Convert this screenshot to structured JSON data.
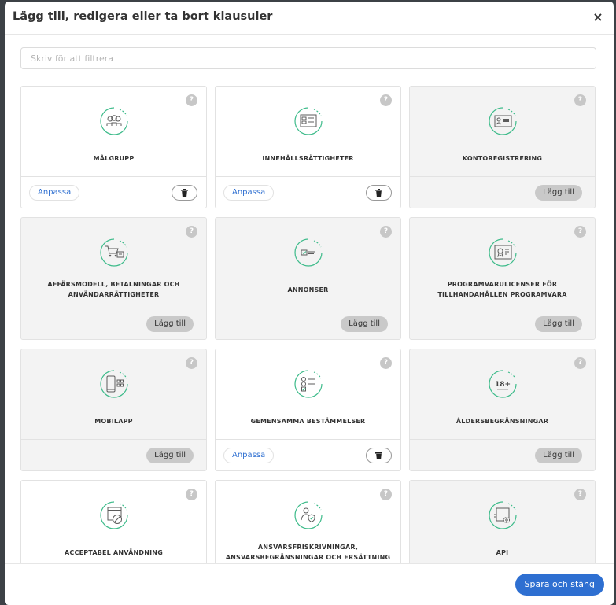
{
  "modal": {
    "title": "Lägg till, redigera eller ta bort klausuler",
    "close": "×"
  },
  "filter": {
    "placeholder": "Skriv för att filtrera",
    "value": ""
  },
  "labels": {
    "customize": "Anpassa",
    "add": "Lägg till",
    "help": "?",
    "save": "Spara och stäng"
  },
  "colors": {
    "accent": "#2e6fd1",
    "icon_green": "#3dbb8a"
  },
  "cards": [
    {
      "title": "MÅLGRUPP",
      "icon": "target-group-icon",
      "active": true
    },
    {
      "title": "INNEHÅLLSRÄTTIGHETER",
      "icon": "content-rights-icon",
      "active": true
    },
    {
      "title": "KONTOREGISTRERING",
      "icon": "account-registration-icon",
      "active": false
    },
    {
      "title": "AFFÄRSMODELL, BETALNINGAR OCH ANVÄNDARRÄTTIGHETER",
      "icon": "shopping-cart-icon",
      "active": false
    },
    {
      "title": "ANNONSER",
      "icon": "ads-icon",
      "active": false
    },
    {
      "title": "PROGRAMVARULICENSER FÖR TILLHANDAHÅLLEN PROGRAMVARA",
      "icon": "software-license-icon",
      "active": false
    },
    {
      "title": "MOBILAPP",
      "icon": "mobile-app-icon",
      "active": false
    },
    {
      "title": "GEMENSAMMA BESTÄMMELSER",
      "icon": "checklist-icon",
      "active": true
    },
    {
      "title": "ÅLDERSBEGRÄNSNINGAR",
      "icon": "age-limit-icon",
      "badge": "18+",
      "active": false
    },
    {
      "title": "ACCEPTABEL ANVÄNDNING",
      "icon": "acceptable-use-icon",
      "active": true
    },
    {
      "title": "ANSVARSFRISKRIVNINGAR, ANSVARSBEGRÄNSNINGAR OCH ERSÄTTNING",
      "icon": "liability-shield-icon",
      "active": true
    },
    {
      "title": "API",
      "icon": "api-gear-icon",
      "active": false
    }
  ]
}
